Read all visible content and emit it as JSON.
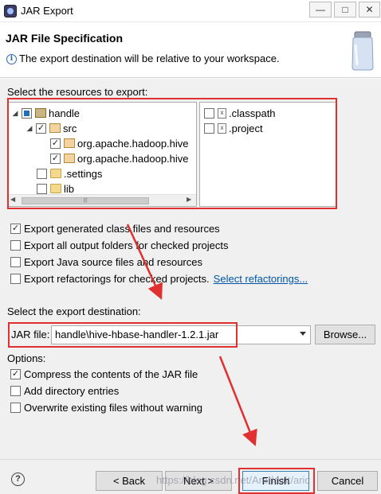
{
  "window": {
    "title": "JAR Export",
    "min_label": "—",
    "max_label": "□",
    "close_label": "✕"
  },
  "header": {
    "title": "JAR File Specification",
    "info": "The export destination will be relative to your workspace.",
    "info_glyph": "i"
  },
  "resources": {
    "label": "Select the resources to export:",
    "tree": [
      {
        "label": "handle",
        "twisty": "◢",
        "state": "partial",
        "icon": "project-icon"
      },
      {
        "label": "src",
        "twisty": "◢",
        "state": "checked",
        "icon": "source-folder-icon"
      },
      {
        "label": "org.apache.hadoop.hive",
        "state": "checked",
        "icon": "package-icon"
      },
      {
        "label": "org.apache.hadoop.hive",
        "state": "checked",
        "icon": "package-icon"
      },
      {
        "label": ".settings",
        "state": "unchecked",
        "icon": "folder-icon"
      },
      {
        "label": "lib",
        "state": "unchecked",
        "icon": "folder-icon"
      }
    ],
    "files": [
      {
        "label": ".classpath",
        "state": "unchecked",
        "icon": "file-icon"
      },
      {
        "label": ".project",
        "state": "unchecked",
        "icon": "file-icon"
      }
    ],
    "file_glyph": "x",
    "scroll_thumb": "|||"
  },
  "export_options": [
    {
      "label": "Export generated class files and resources",
      "checked": true
    },
    {
      "label": "Export all output folders for checked projects",
      "checked": false
    },
    {
      "label": "Export Java source files and resources",
      "checked": false
    },
    {
      "label": "Export refactorings for checked projects.",
      "checked": false
    }
  ],
  "select_refactorings": "Select refactorings...",
  "destination": {
    "label": "Select the export destination:",
    "jar_label": "JAR file:",
    "jar_value": "handle\\hive-hbase-handler-1.2.1.jar",
    "browse": "Browse..."
  },
  "options": {
    "label": "Options:",
    "items": [
      {
        "label": "Compress the contents of the JAR file",
        "checked": true
      },
      {
        "label": "Add directory entries",
        "checked": false
      },
      {
        "label": "Overwrite existing files without warning",
        "checked": false
      }
    ]
  },
  "footer": {
    "help": "?",
    "back": "< Back",
    "next": "Next >",
    "finish": "Finish",
    "cancel": "Cancel"
  },
  "watermark": "https://blog.csdn.net/Arerldoit/aric",
  "check_glyph": "✓",
  "colors": {
    "annotation": "#e03030",
    "link": "#0055aa",
    "finish_border": "#3c7fb1"
  }
}
